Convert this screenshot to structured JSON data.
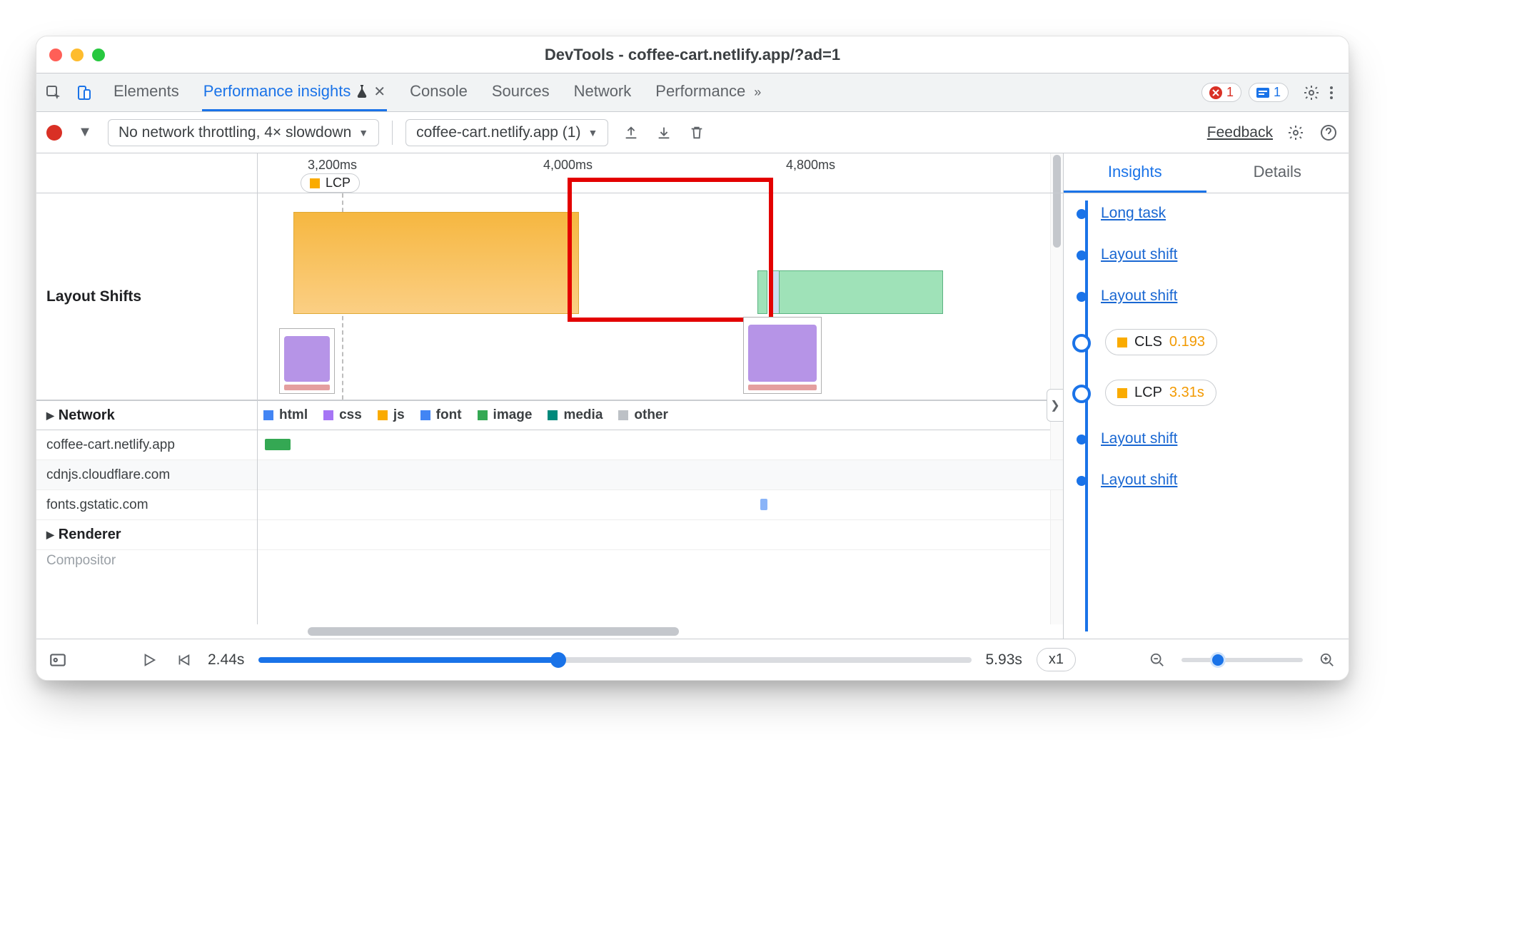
{
  "window": {
    "title": "DevTools - coffee-cart.netlify.app/?ad=1"
  },
  "tabs": {
    "items": [
      "Elements",
      "Performance insights",
      "Console",
      "Sources",
      "Network",
      "Performance"
    ],
    "activeIndex": 1,
    "errors": "1",
    "issues": "1"
  },
  "toolbar": {
    "throttling": "No network throttling, 4× slowdown",
    "recording": "coffee-cart.netlify.app (1)",
    "feedback": "Feedback"
  },
  "ruler": {
    "ticks": [
      "3,200ms",
      "4,000ms",
      "4,800ms"
    ],
    "lcpChip": "LCP"
  },
  "sections": {
    "layoutShifts": "Layout Shifts",
    "network": "Network",
    "renderer": "Renderer",
    "compositor": "Compositor"
  },
  "legend": {
    "html": "html",
    "css": "css",
    "js": "js",
    "font": "font",
    "image": "image",
    "media": "media",
    "other": "other"
  },
  "hosts": [
    "coffee-cart.netlify.app",
    "cdnjs.cloudflare.com",
    "fonts.gstatic.com"
  ],
  "insightsPane": {
    "tabs": [
      "Insights",
      "Details"
    ],
    "activeIndex": 0,
    "items": [
      {
        "type": "link",
        "label": "Long task"
      },
      {
        "type": "link",
        "label": "Layout shift"
      },
      {
        "type": "link",
        "label": "Layout shift"
      },
      {
        "type": "metric",
        "name": "CLS",
        "value": "0.193",
        "color": "#faab00"
      },
      {
        "type": "metric",
        "name": "LCP",
        "value": "3.31s",
        "color": "#faab00"
      },
      {
        "type": "link",
        "label": "Layout shift"
      },
      {
        "type": "link",
        "label": "Layout shift"
      }
    ]
  },
  "bottom": {
    "start": "2.44s",
    "end": "5.93s",
    "speed": "x1"
  }
}
